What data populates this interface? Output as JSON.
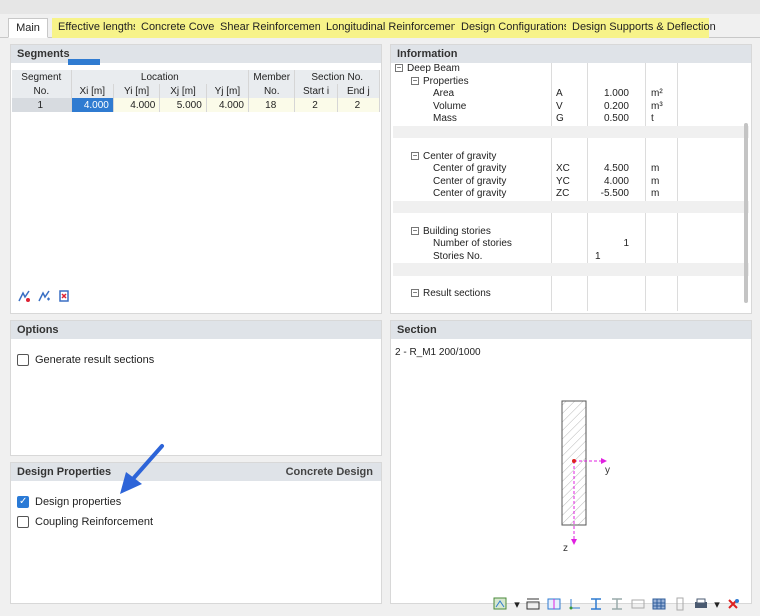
{
  "tabs": [
    {
      "label": "Main",
      "active": true,
      "highlighted": false
    },
    {
      "label": "Effective lengths",
      "highlighted": true
    },
    {
      "label": "Concrete Cover",
      "highlighted": true
    },
    {
      "label": "Shear Reinforcement",
      "highlighted": true
    },
    {
      "label": "Longitudinal Reinforcement",
      "highlighted": true
    },
    {
      "label": "Design Configurations",
      "highlighted": true
    },
    {
      "label": "Design Supports & Deflection",
      "highlighted": true
    }
  ],
  "segments": {
    "title": "Segments",
    "headers": {
      "segment": "Segment",
      "no": "No.",
      "location": "Location",
      "xi": "Xi [m]",
      "yi": "Yi [m]",
      "xj": "Xj [m]",
      "yj": "Yj [m]",
      "member": "Member",
      "member_no": "No.",
      "section_no": "Section No.",
      "start_i": "Start i",
      "end_j": "End j"
    },
    "rows": [
      {
        "no": "1",
        "xi": "4.000",
        "yi": "4.000",
        "xj": "5.000",
        "yj": "4.000",
        "member": "18",
        "start": "2",
        "end": "2"
      }
    ]
  },
  "information": {
    "title": "Information",
    "root": "Deep Beam",
    "properties": {
      "label": "Properties",
      "items": [
        {
          "label": "Area",
          "sym": "A",
          "val": "1.000",
          "unit": "m²"
        },
        {
          "label": "Volume",
          "sym": "V",
          "val": "0.200",
          "unit": "m³"
        },
        {
          "label": "Mass",
          "sym": "G",
          "val": "0.500",
          "unit": "t"
        }
      ]
    },
    "gravity": {
      "label": "Center of gravity",
      "items": [
        {
          "label": "Center of gravity",
          "sym": "XC",
          "val": "4.500",
          "unit": "m"
        },
        {
          "label": "Center of gravity",
          "sym": "YC",
          "val": "4.000",
          "unit": "m"
        },
        {
          "label": "Center of gravity",
          "sym": "ZC",
          "val": "-5.500",
          "unit": "m"
        }
      ]
    },
    "stories": {
      "label": "Building stories",
      "items": [
        {
          "label": "Number of stories",
          "val": "1"
        },
        {
          "label": "Stories No.",
          "val": "1"
        }
      ]
    },
    "result_sections": "Result sections"
  },
  "options": {
    "title": "Options",
    "generate_label": "Generate result sections",
    "generate_checked": false
  },
  "design": {
    "title": "Design Properties",
    "right_label": "Concrete Design",
    "design_label": "Design properties",
    "design_checked": true,
    "coupling_label": "Coupling Reinforcement",
    "coupling_checked": false
  },
  "section": {
    "title": "Section",
    "name": "2 - R_M1 200/1000",
    "axis_y": "y",
    "axis_z": "z"
  },
  "colors": {
    "accent": "#2f7bd1",
    "tab_highlight": "#f7f389",
    "axis": "#e020e0",
    "arrow": "#2d64d8"
  }
}
